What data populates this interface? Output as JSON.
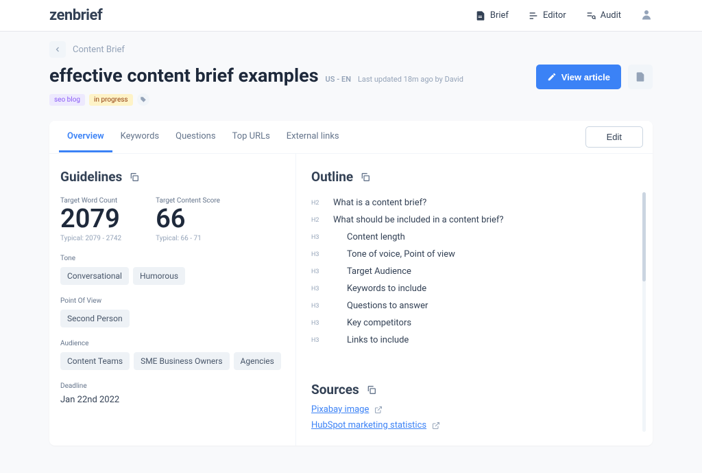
{
  "brand": "zenbrief",
  "topnav": {
    "brief": "Brief",
    "editor": "Editor",
    "audit": "Audit"
  },
  "breadcrumb": "Content Brief",
  "title": "effective content brief examples",
  "locale": "US - EN",
  "last_updated": "Last updated 18m ago by David",
  "tags": {
    "blog": "seo blog",
    "status": "in progress"
  },
  "actions": {
    "view_article": "View article"
  },
  "tabs": {
    "overview": "Overview",
    "keywords": "Keywords",
    "questions": "Questions",
    "top_urls": "Top URLs",
    "external_links": "External links",
    "edit": "Edit"
  },
  "guidelines": {
    "title": "Guidelines",
    "word_count_label": "Target Word Count",
    "word_count_value": "2079",
    "word_count_sub": "Typical: 2079 - 2742",
    "score_label": "Target Content Score",
    "score_value": "66",
    "score_sub": "Typical: 66 - 71",
    "tone_label": "Tone",
    "tone": [
      "Conversational",
      "Humorous"
    ],
    "pov_label": "Point Of View",
    "pov": [
      "Second Person"
    ],
    "audience_label": "Audience",
    "audience": [
      "Content Teams",
      "SME Business Owners",
      "Agencies"
    ],
    "deadline_label": "Deadline",
    "deadline_value": "Jan 22nd 2022"
  },
  "outline": {
    "title": "Outline",
    "items": [
      {
        "level": "H2",
        "text": "What is a content brief?"
      },
      {
        "level": "H2",
        "text": "What should be included in a content brief?"
      },
      {
        "level": "H3",
        "text": "Content length"
      },
      {
        "level": "H3",
        "text": "Tone of voice, Point of view"
      },
      {
        "level": "H3",
        "text": "Target Audience"
      },
      {
        "level": "H3",
        "text": "Keywords to include"
      },
      {
        "level": "H3",
        "text": "Questions to answer"
      },
      {
        "level": "H3",
        "text": "Key competitors"
      },
      {
        "level": "H3",
        "text": "Links to include"
      }
    ]
  },
  "sources": {
    "title": "Sources",
    "links": [
      "Pixabay image",
      "HubSpot marketing statistics"
    ]
  }
}
